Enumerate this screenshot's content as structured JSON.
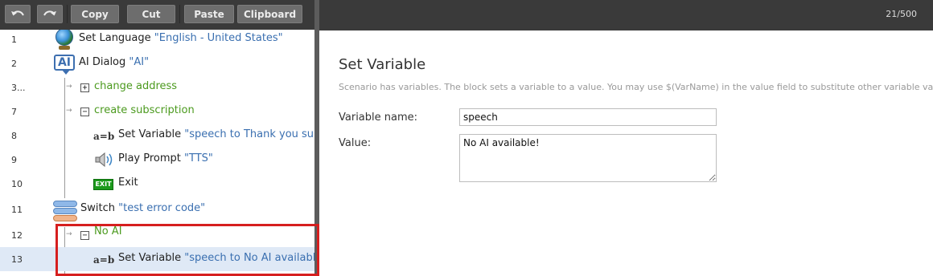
{
  "toolbar": {
    "undo_icon": "undo-icon",
    "redo_icon": "redo-icon",
    "copy_label": "Copy",
    "cut_label": "Cut",
    "paste_label": "Paste",
    "clipboard_label": "Clipboard"
  },
  "header": {
    "counter": "21/500"
  },
  "tree": {
    "rows": [
      {
        "num": "1",
        "label": "Set Language ",
        "value": "\"English - United States\"",
        "icon": "globe-icon"
      },
      {
        "num": "2",
        "label": "AI Dialog ",
        "value": "\"AI\"",
        "icon": "ai-dialog-icon",
        "icon_text": "AI"
      },
      {
        "num": "3...",
        "label": "change address",
        "toggle": "+"
      },
      {
        "num": "7",
        "label": "create subscription",
        "toggle": "−"
      },
      {
        "num": "8",
        "label": "Set Variable ",
        "value": "\"speech to Thank you subscr",
        "icon": "set-variable-icon",
        "icon_text": "a=b"
      },
      {
        "num": "9",
        "label": "Play Prompt ",
        "value": "\"TTS\"",
        "icon": "speaker-icon"
      },
      {
        "num": "10",
        "label": "Exit",
        "icon": "exit-icon",
        "icon_text": "EXIT"
      },
      {
        "num": "11",
        "label": "Switch ",
        "value": "\"test error code\"",
        "icon": "switch-icon"
      },
      {
        "num": "12",
        "label": "No AI",
        "toggle": "−"
      },
      {
        "num": "13",
        "label": "Set Variable ",
        "value": "\"speech to No AI available!\"",
        "icon": "set-variable-icon",
        "icon_text": "a=b"
      }
    ]
  },
  "properties": {
    "title": "Set Variable",
    "description": "Scenario has variables. The block sets a variable to a value. You may use $(VarName) in the value field to substitute other variable values.",
    "var_name_label": "Variable name:",
    "var_name_value": "speech",
    "value_label": "Value:",
    "value_value": "No AI available!"
  },
  "colors": {
    "toolbar_bg": "#3a3a3a",
    "button_bg": "#6d6d6d",
    "value_text": "#3a6fb0",
    "group_text": "#4b9a1e",
    "selection": "#dfe9f6",
    "highlight_border": "#d61f1f"
  }
}
